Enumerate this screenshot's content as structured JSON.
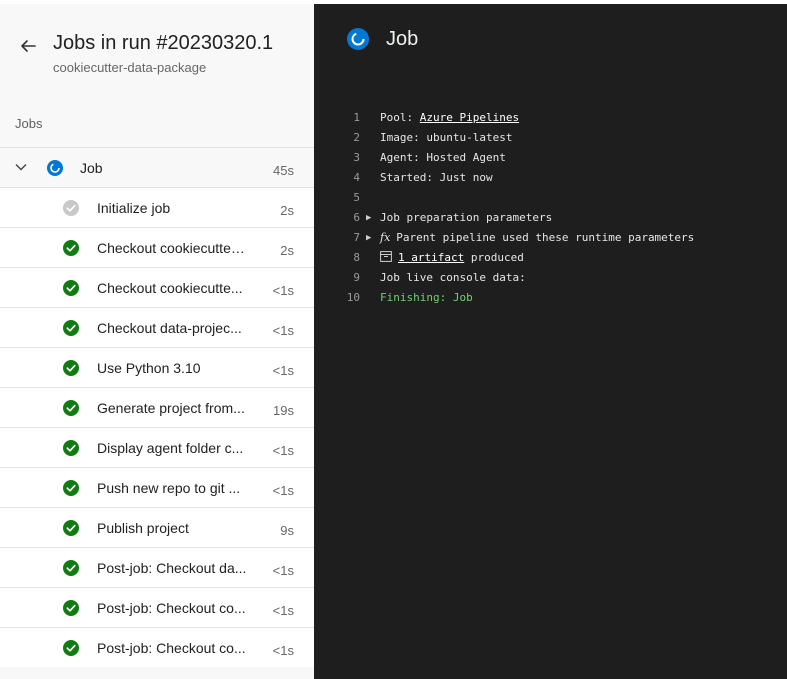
{
  "header": {
    "title": "Jobs in run #20230320.1",
    "subtitle": "cookiecutter-data-package"
  },
  "sidebar": {
    "section_label": "Jobs",
    "job": {
      "name": "Job",
      "duration": "45s",
      "status": "running"
    },
    "steps": [
      {
        "name": "Initialize job",
        "duration": "2s",
        "status": "pending"
      },
      {
        "name": "Checkout cookiecutter-...",
        "duration": "2s",
        "status": "success"
      },
      {
        "name": "Checkout cookiecutte...",
        "duration": "<1s",
        "status": "success"
      },
      {
        "name": "Checkout data-projec...",
        "duration": "<1s",
        "status": "success"
      },
      {
        "name": "Use Python 3.10",
        "duration": "<1s",
        "status": "success"
      },
      {
        "name": "Generate project from...",
        "duration": "19s",
        "status": "success"
      },
      {
        "name": "Display agent folder c...",
        "duration": "<1s",
        "status": "success"
      },
      {
        "name": "Push new repo to git ...",
        "duration": "<1s",
        "status": "success"
      },
      {
        "name": "Publish project",
        "duration": "9s",
        "status": "success"
      },
      {
        "name": "Post-job: Checkout da...",
        "duration": "<1s",
        "status": "success"
      },
      {
        "name": "Post-job: Checkout co...",
        "duration": "<1s",
        "status": "success"
      },
      {
        "name": "Post-job: Checkout co...",
        "duration": "<1s",
        "status": "success"
      }
    ]
  },
  "detail": {
    "title": "Job",
    "lines": [
      {
        "num": "1",
        "prefix": "Pool: ",
        "link": "Azure Pipelines",
        "suffix": ""
      },
      {
        "num": "2",
        "prefix": "Image: ubuntu-latest"
      },
      {
        "num": "3",
        "prefix": "Agent: Hosted Agent"
      },
      {
        "num": "4",
        "prefix": "Started: Just now"
      },
      {
        "num": "5",
        "prefix": ""
      },
      {
        "num": "6",
        "twisty": "▶",
        "prefix": "Job preparation parameters"
      },
      {
        "num": "7",
        "twisty": "▶",
        "icon": "fx",
        "prefix": "Parent pipeline used these runtime parameters"
      },
      {
        "num": "8",
        "icon": "artifact-icon",
        "link": "1 artifact",
        "suffix": " produced"
      },
      {
        "num": "9",
        "prefix": "Job live console data:"
      },
      {
        "num": "10",
        "prefix": "Finishing: Job",
        "color": "green"
      }
    ]
  },
  "colors": {
    "success": "#107c10",
    "pending": "#c8c8c8",
    "running": "#0078d4",
    "console_bg": "#1e1e1e"
  }
}
